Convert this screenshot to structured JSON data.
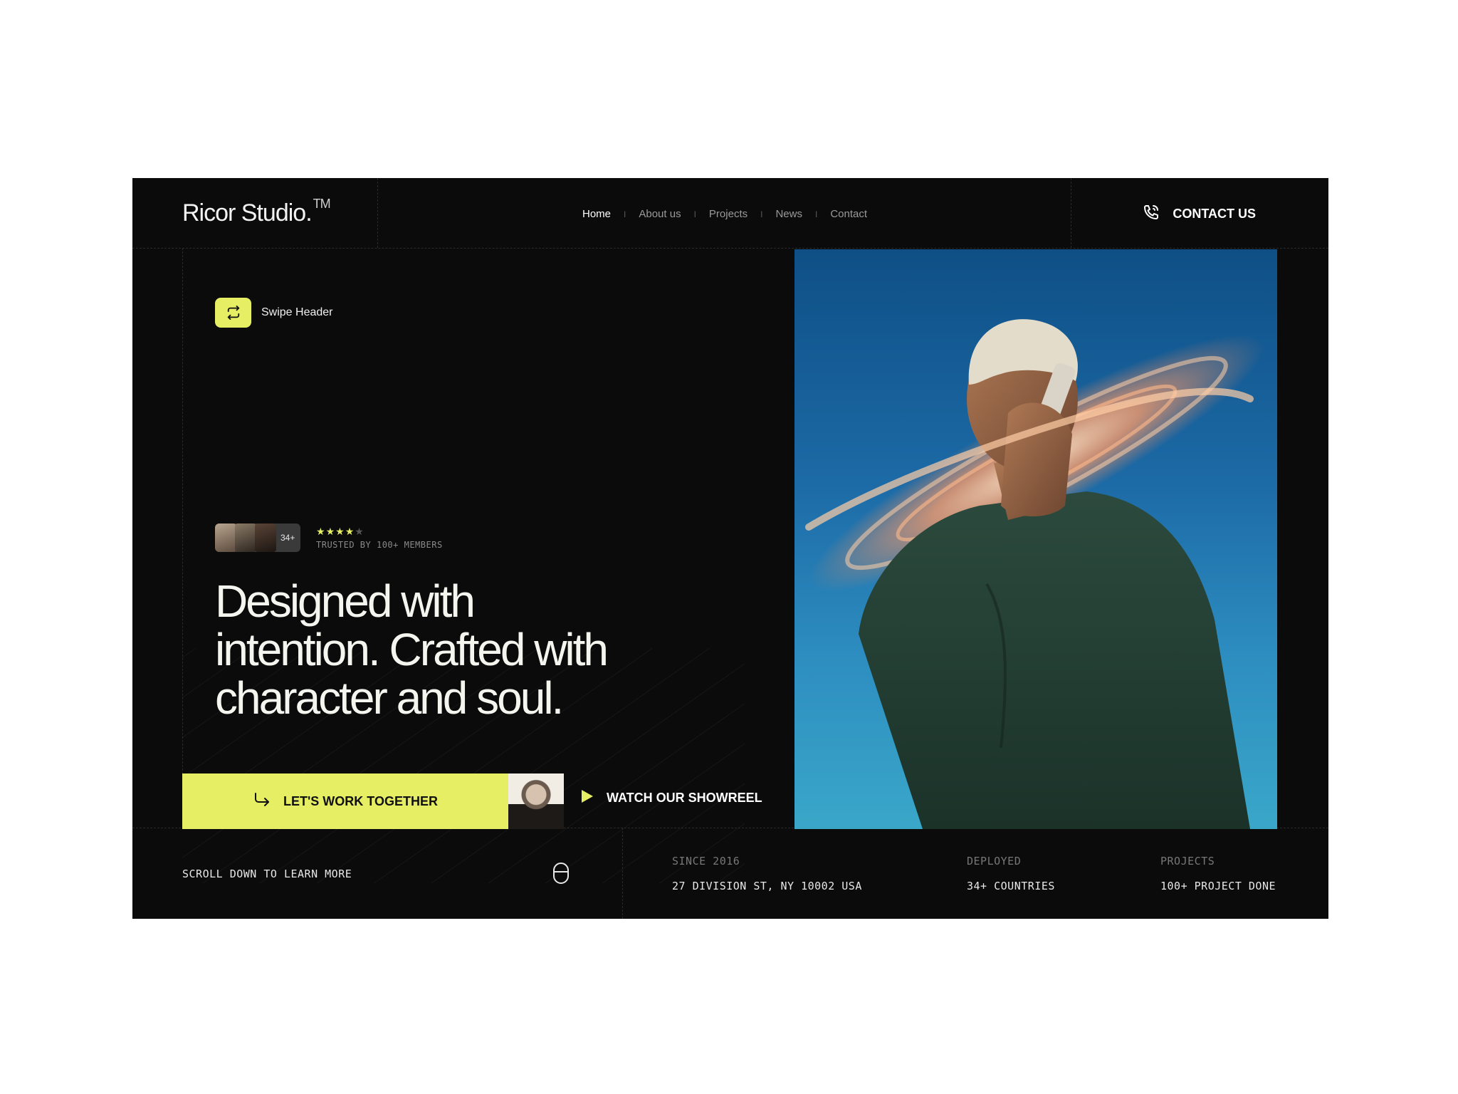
{
  "header": {
    "logo": "Ricor Studio.",
    "logo_mark": "TM",
    "nav": [
      {
        "label": "Home",
        "active": true
      },
      {
        "label": "About us",
        "active": false
      },
      {
        "label": "Projects",
        "active": false
      },
      {
        "label": "News",
        "active": false
      },
      {
        "label": "Contact",
        "active": false
      }
    ],
    "contact_label": "CONTACT US",
    "contact_icon": "phone-icon"
  },
  "swipe": {
    "label": "Swipe Header",
    "icon": "repeat-icon"
  },
  "trust": {
    "avatar_count": "34+",
    "rating": 4,
    "rating_max": 5,
    "text": "TRUSTED BY 100+ MEMBERS"
  },
  "hero": {
    "headline_line1": "Designed with",
    "headline_line2": "intention. Crafted with",
    "headline_line3": "character and soul."
  },
  "cta": {
    "primary_label": "LET'S WORK TOGETHER",
    "primary_icon": "arrow-turn-right-icon",
    "secondary_label": "WATCH OUR SHOWREEL",
    "secondary_icon": "play-icon"
  },
  "footer": {
    "scroll_text": "SCROLL DOWN TO LEARN MORE",
    "scroll_icon": "mouse-icon",
    "stats": [
      {
        "label": "SINCE 2016",
        "value": "27 DIVISION ST, NY 10002 USA"
      },
      {
        "label": "DEPLOYED",
        "value": "34+ COUNTRIES"
      },
      {
        "label": "PROJECTS",
        "value": "100+ PROJECT DONE"
      }
    ]
  },
  "colors": {
    "background": "#0b0b0b",
    "accent": "#e6ee64",
    "text": "#f5f5f0",
    "muted": "#8a8a8a"
  }
}
